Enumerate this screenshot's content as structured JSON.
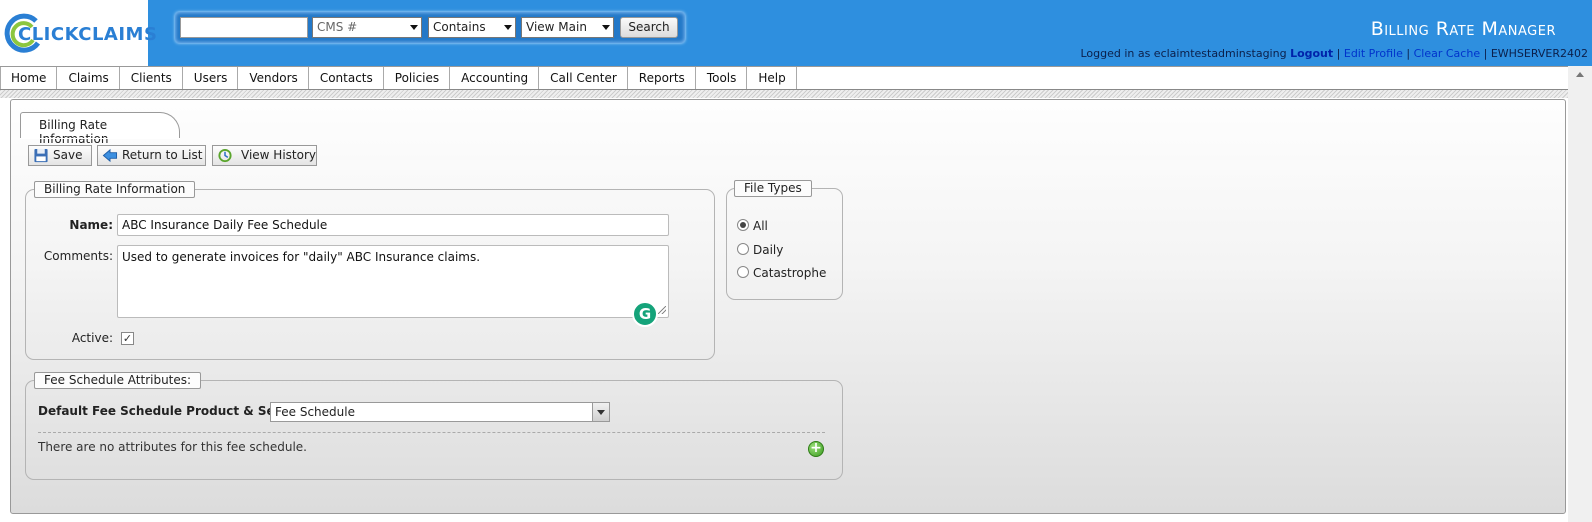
{
  "header": {
    "logo": {
      "part1": "CLICK",
      "part2": "CLAIMS"
    },
    "search": {
      "input_value": "",
      "field_select": "CMS #",
      "operator_select": "Contains",
      "view_select": "View Main",
      "button": "Search"
    },
    "title": "Billing Rate Manager",
    "login": {
      "prefix": "Logged in as eclaimtestadminstaging",
      "logout": "Logout",
      "edit_profile": "Edit Profile",
      "clear_cache": "Clear Cache",
      "server": "EWHSERVER2402",
      "sep": "|"
    }
  },
  "nav": [
    "Home",
    "Claims",
    "Clients",
    "Users",
    "Vendors",
    "Contacts",
    "Policies",
    "Accounting",
    "Call Center",
    "Reports",
    "Tools",
    "Help"
  ],
  "tab": {
    "label": "Billing Rate Information"
  },
  "toolbar": {
    "save": "Save",
    "return": "Return to List",
    "history": "View History"
  },
  "billing_info": {
    "legend": "Billing Rate Information",
    "name_label": "Name:",
    "name_value": "ABC Insurance Daily Fee Schedule",
    "comments_label": "Comments:",
    "comments_value": "Used to generate invoices for \"daily\" ABC Insurance claims.",
    "active_label": "Active:",
    "active_checked": true
  },
  "file_types": {
    "legend": "File Types",
    "options": [
      "All",
      "Daily",
      "Catastrophe"
    ],
    "selected": "All"
  },
  "fee_schedule": {
    "legend": "Fee Schedule Attributes:",
    "default_label": "Default Fee Schedule Product & Service:",
    "default_value": "Fee Schedule",
    "empty_message": "There are no attributes for this fee schedule."
  },
  "colors": {
    "header_bg": "#2e8fdf",
    "accent_green": "#3a9a1f",
    "grammarly": "#15a37a"
  },
  "icons": {
    "save": "floppy-disk-icon",
    "return": "back-arrow-icon",
    "history": "history-icon",
    "add": "add-circle-icon",
    "grammarly": "grammarly-icon"
  }
}
